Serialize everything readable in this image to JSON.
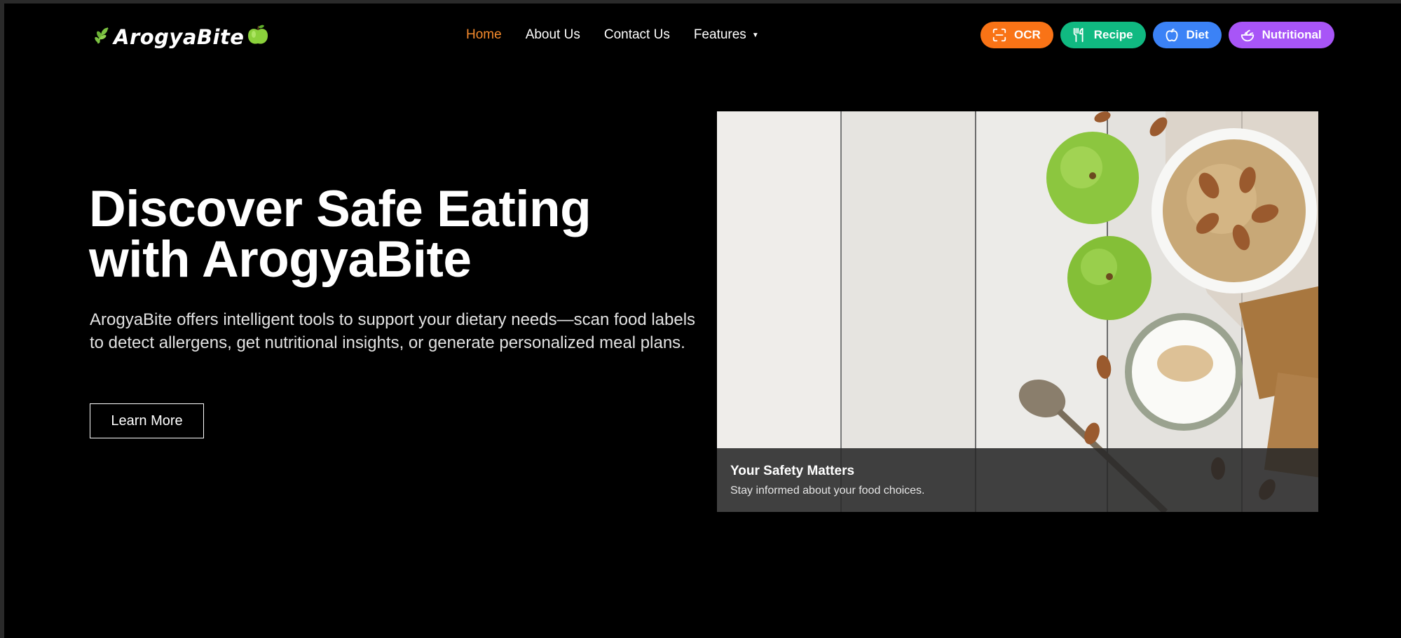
{
  "brand": {
    "name": "ArogyaBite"
  },
  "nav": {
    "links": [
      "Home",
      "About Us",
      "Contact Us"
    ],
    "features_label": "Features",
    "active": "Home"
  },
  "pills": [
    {
      "label": "OCR",
      "color": "#f97316",
      "icon": "scan-icon"
    },
    {
      "label": "Recipe",
      "color": "#10b981",
      "icon": "utensils-icon"
    },
    {
      "label": "Diet",
      "color": "#3b82f6",
      "icon": "apple-icon"
    },
    {
      "label": "Nutritional",
      "color": "#a855f7",
      "icon": "salad-icon"
    }
  ],
  "hero": {
    "title_line1": "Discover Safe Eating",
    "title_line2": "with ArogyaBite",
    "description": "ArogyaBite offers intelligent tools to support your dietary needs—scan food labels to detect allergens, get nutritional insights, or generate personalized meal plans.",
    "button_label": "Learn More"
  },
  "card": {
    "caption_title": "Your Safety Matters",
    "caption_subtitle": "Stay informed about your food choices."
  },
  "colors": {
    "accent": "#f58a2c",
    "background": "#000000"
  }
}
